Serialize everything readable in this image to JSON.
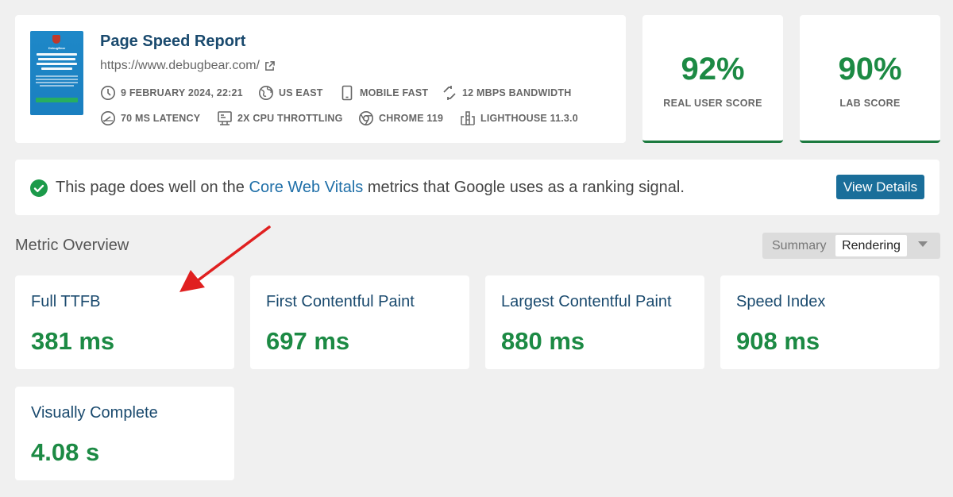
{
  "report": {
    "title": "Page Speed Report",
    "url": "https://www.debugbear.com/",
    "thumbnail": {
      "brand": "DebugBear",
      "headline": "Monitor Page Speed and Core Web Vitals"
    },
    "meta": [
      {
        "icon": "clock-icon",
        "label": "9 FEBRUARY 2024, 22:21"
      },
      {
        "icon": "globe-icon",
        "label": "US EAST"
      },
      {
        "icon": "mobile-icon",
        "label": "MOBILE FAST"
      },
      {
        "icon": "bandwidth-icon",
        "label": "12 MBPS BANDWIDTH"
      },
      {
        "icon": "latency-gauge-icon",
        "label": "70 MS LATENCY"
      },
      {
        "icon": "cpu-icon",
        "label": "2X CPU THROTTLING"
      },
      {
        "icon": "chrome-icon",
        "label": "CHROME 119"
      },
      {
        "icon": "lighthouse-icon",
        "label": "LIGHTHOUSE 11.3.0"
      }
    ]
  },
  "scores": {
    "real_user": {
      "value": "92%",
      "label": "REAL USER SCORE"
    },
    "lab": {
      "value": "90%",
      "label": "LAB SCORE"
    }
  },
  "cwv": {
    "text_before": "This page does well on the ",
    "link": "Core Web Vitals",
    "text_after": " metrics that Google uses as a ranking signal.",
    "button": "View Details"
  },
  "overview": {
    "title": "Metric Overview",
    "toggle": {
      "options": [
        "Summary",
        "Rendering"
      ],
      "selected": "Rendering"
    }
  },
  "metrics": [
    {
      "name": "Full TTFB",
      "value": "381 ms"
    },
    {
      "name": "First Contentful Paint",
      "value": "697 ms"
    },
    {
      "name": "Largest Contentful Paint",
      "value": "880 ms"
    },
    {
      "name": "Speed Index",
      "value": "908 ms"
    },
    {
      "name": "Visually Complete",
      "value": "4.08 s"
    }
  ],
  "colors": {
    "good": "#1c8a44",
    "link": "#1f6fa8",
    "button": "#1a6e9a",
    "arrow": "#e02020"
  }
}
